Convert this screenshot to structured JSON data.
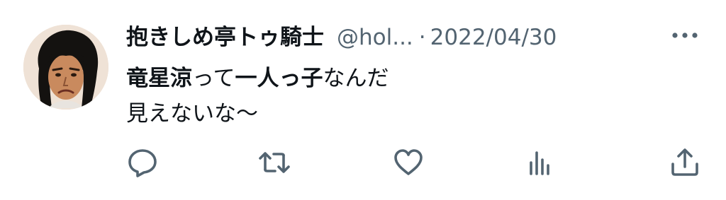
{
  "tweet": {
    "author": {
      "display_name": "抱きしめ亭トゥ騎士",
      "handle": "@hol...",
      "separator": "·",
      "date": "2022/04/30"
    },
    "text": {
      "line1": [
        {
          "text": "竜星涼",
          "bold": true
        },
        {
          "text": "って",
          "bold": false
        },
        {
          "text": "一人っ子",
          "bold": true
        },
        {
          "text": "なんだ",
          "bold": false
        }
      ],
      "line2": "見えないな〜"
    },
    "actions": [
      {
        "icon": "reply-icon"
      },
      {
        "icon": "retweet-icon"
      },
      {
        "icon": "like-icon"
      },
      {
        "icon": "views-icon"
      },
      {
        "icon": "share-icon"
      }
    ],
    "more_icon": "more-icon"
  },
  "colors": {
    "text_primary": "#0f1419",
    "text_secondary": "#536471",
    "background": "#ffffff"
  }
}
